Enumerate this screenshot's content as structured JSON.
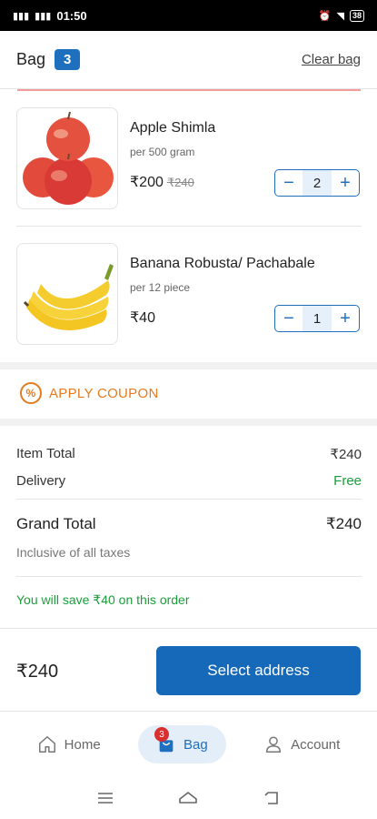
{
  "status": {
    "time": "01:50",
    "battery": "38"
  },
  "header": {
    "title": "Bag",
    "count": "3",
    "clear_label": "Clear bag"
  },
  "items": [
    {
      "name": "Apple Shimla",
      "unit": "per 500 gram",
      "price": "₹200",
      "mrp": "₹240",
      "qty": "2",
      "image": "apples-image"
    },
    {
      "name": "Banana Robusta/ Pachabale",
      "unit": "per 12 piece",
      "price": "₹40",
      "mrp": "",
      "qty": "1",
      "image": "bananas-image"
    }
  ],
  "coupon": {
    "label": "APPLY COUPON",
    "icon": "percent-icon"
  },
  "summary": {
    "item_total_label": "Item Total",
    "item_total": "₹240",
    "delivery_label": "Delivery",
    "delivery": "Free",
    "grand_total_label": "Grand Total",
    "grand_total": "₹240",
    "taxes_note": "Inclusive of all taxes",
    "savings_note": "You will save ₹40 on this order"
  },
  "footer": {
    "total": "₹240",
    "cta_label": "Select address"
  },
  "tabs": [
    {
      "label": "Home",
      "icon": "home-icon"
    },
    {
      "label": "Bag",
      "icon": "bag-icon",
      "badge": "3",
      "active": true
    },
    {
      "label": "Account",
      "icon": "person-icon"
    }
  ],
  "colors": {
    "accent": "#1f6fbf",
    "cta": "#1669b8",
    "coupon": "#e57a1f",
    "positive": "#1a9e3a",
    "badge_red": "#d92f2f"
  }
}
